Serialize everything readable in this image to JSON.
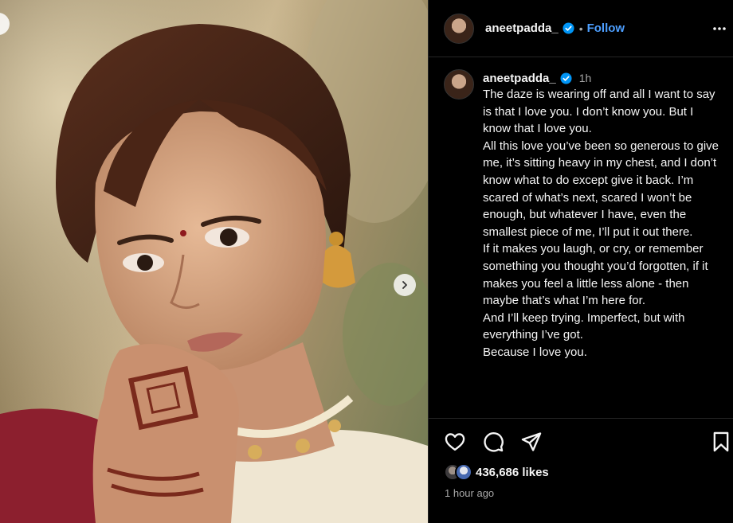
{
  "post": {
    "username": "aneetpadda_",
    "follow_label": "Follow",
    "separator": "•",
    "caption_time": "1h",
    "caption": "The daze is wearing off and all I want to say is that I love you. I don’t know you. But I know that I love you.\nAll this love you’ve been so generous to give me, it’s sitting heavy in my chest, and I don’t know what to do except give it back. I’m scared of what’s next, scared I won’t be enough, but whatever I have, even the smallest piece of me, I’ll put it out there.\nIf it makes you laugh, or cry, or remember something you thought you’d forgotten, if it makes you feel a little less alone - then maybe that’s what I’m here for.\nAnd I’ll keep trying. Imperfect, but with everything I’ve got.\nBecause I love you.",
    "likes": "436,686 likes",
    "posted_ago": "1 hour ago"
  },
  "icons": {
    "verified": "verified-badge-icon",
    "more": "more-options-icon",
    "like": "heart-icon",
    "comment": "comment-icon",
    "share": "send-icon",
    "save": "bookmark-icon",
    "next": "chevron-right-icon"
  },
  "colors": {
    "background": "#000000",
    "text": "#f5f5f5",
    "secondary_text": "#a8a8a8",
    "link": "#4d9fff",
    "verified": "#0095f6",
    "divider": "#262626"
  }
}
